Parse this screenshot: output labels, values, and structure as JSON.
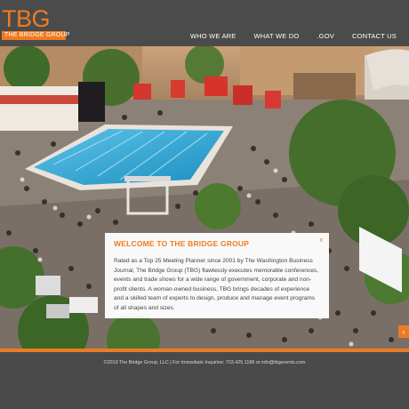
{
  "brand": {
    "logo_text": "TBG",
    "logo_subtitle": "THE BRIDGE GROUP",
    "accent_color": "#ee7b22",
    "header_bg": "#4b4b4b"
  },
  "nav": {
    "items": [
      {
        "label": "WHO WE ARE"
      },
      {
        "label": "WHAT WE DO"
      },
      {
        "label": ".GOV"
      },
      {
        "label": "CONTACT US"
      }
    ]
  },
  "hero": {
    "description_icon": "event-photo"
  },
  "welcome": {
    "title": "WELCOME TO THE BRIDGE GROUP",
    "close": "x",
    "body": "Rated as a Top 25 Meeting Planner since 2001 by The Washington Business Journal, The Bridge Group (TBG) flawlessly executes memorable conferences, events and trade shows for a wide range of government, corporate and non-profit clients. A woman-owned business, TBG brings decades of experience and a skilled team of experts to design, produce and manage event programs of all shapes and sizes."
  },
  "slider": {
    "next_icon": "chevron-right-icon",
    "next_glyph": "‹"
  },
  "footer": {
    "text": "©2013 The Bridge Group, LLC | For Immediate Inquiries: 703.425.1186 or info@tbgevents.com"
  }
}
